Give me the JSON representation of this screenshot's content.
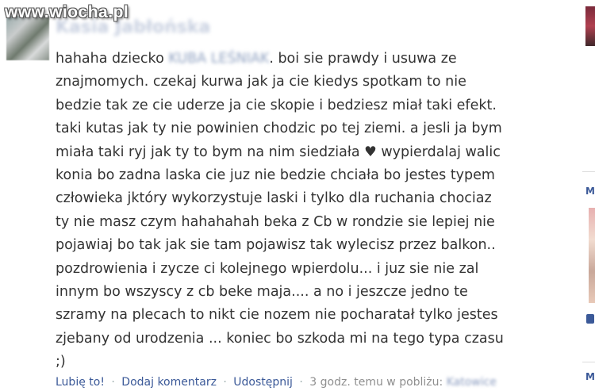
{
  "watermark": "www.wiocha.pl",
  "post": {
    "author_blurred": "Kasia Jabłońska",
    "text_before_name": "hahaha dziecko ",
    "blurred_name": "KUBA LEŚNIAK",
    "text_after_name": ". boi sie prawdy i usuwa ze znajmomych. czekaj kurwa jak ja cie kiedys spotkam to nie bedzie tak ze cie uderze ja cie skopie i bedziesz miał taki efekt. taki kutas jak ty nie powinien chodzic po tej ziemi. a jesli ja bym miała taki ryj jak ty to bym na nim siedziała ♥ wypierdalaj walic konia bo zadna laska cie juz nie bedzie chciała bo jestes typem człowieka jktóry wykorzystuje laski i tylko dla ruchania chociaz ty nie masz czym hahahahah beka z Cb w rondzie sie lepiej nie pojawiaj bo tak jak sie tam pojawisz tak wylecisz przez balkon.. pozdrowienia i zycze ci kolejnego wpierdolu... i juz sie nie zal innym bo wszyscy z cb beke maja.... a no i jeszcze jedno te szramy na plecach to nikt cie nozem nie pocharatał tylko jestes zjebany od urodzenia ... koniec bo szkoda mi na tego typa czasu ;)"
  },
  "actions": {
    "like": "Lubię to!",
    "comment": "Dodaj komentarz",
    "share": "Udostępnij",
    "time": "3 godz. temu w pobliżu: ",
    "place": "Katowice",
    "separator": "·"
  },
  "right_column": {
    "letter": "M"
  }
}
